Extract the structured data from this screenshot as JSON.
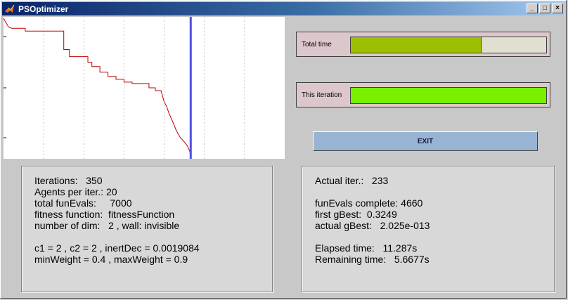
{
  "window": {
    "title": "PSOptimizer",
    "minimize_label": "_",
    "maximize_label": "□",
    "close_label": "×"
  },
  "chart_data": {
    "type": "line",
    "title": "",
    "xlabel": "",
    "ylabel": "",
    "xlim": [
      0,
      350
    ],
    "ylim_descriptive": "log fitness (unlabeled)",
    "grid": true,
    "current_iteration_marker": 233,
    "marker_color": "#5050e0",
    "line_color": "#c00000"
  },
  "progress": {
    "total": {
      "label": "Total time",
      "fraction": 0.667,
      "color": "#9cc000"
    },
    "iteration": {
      "label": "This iteration",
      "fraction": 1.0,
      "color": "#78f000"
    }
  },
  "exit_button": {
    "label": "EXIT"
  },
  "left_info": {
    "lines": [
      "Iterations:   350",
      "Agents per iter.: 20",
      "total funEvals:     7000",
      "fitness function:  fitnessFunction",
      "number of dim:   2 , wall: invisible",
      "",
      "c1 = 2 , c2 = 2 , inertDec = 0.0019084",
      "minWeight = 0.4 , maxWeight = 0.9"
    ]
  },
  "right_info": {
    "lines": [
      "Actual iter.:   233",
      "",
      "funEvals complete: 4660",
      "first gBest:  0.3249",
      "actual gBest:   2.025e-013",
      "",
      "Elapsed time:   11.287s",
      "Remaining time:   5.6677s"
    ]
  },
  "colors": {
    "panel_bg": "#dcc8cc",
    "track_bg": "#e0dfd0",
    "exit_bg": "#98b4d2"
  }
}
